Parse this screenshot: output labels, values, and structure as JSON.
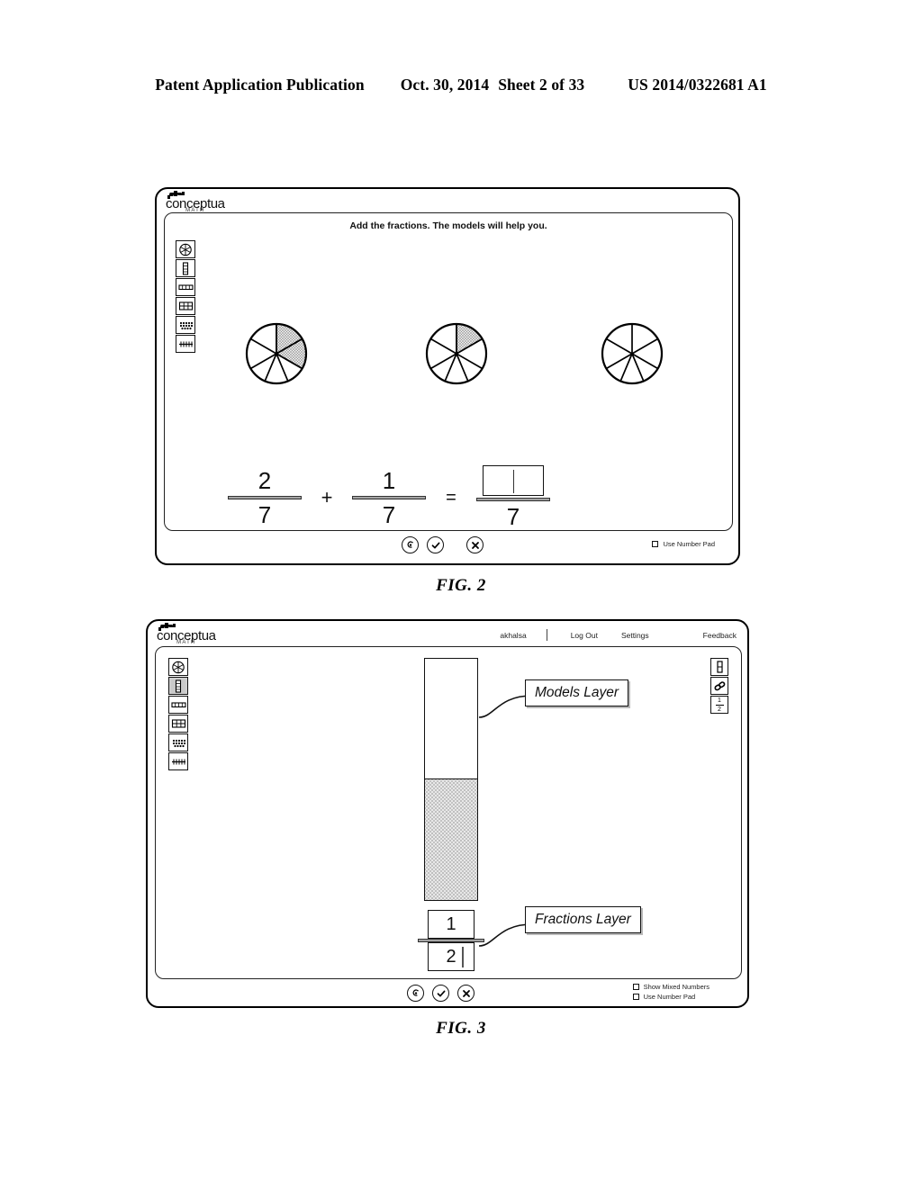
{
  "patent_header": {
    "publication": "Patent Application Publication",
    "date": "Oct. 30, 2014",
    "sheet": "Sheet 2 of 33",
    "number": "US 2014/0322681 A1"
  },
  "figures": [
    {
      "caption": "FIG. 2",
      "logo": {
        "word": "conceptua",
        "sub": "MATH"
      },
      "prompt": "Add the fractions. The models will help you.",
      "palette": [
        {
          "name": "circle-model-tool",
          "label": "Circle Model",
          "selected": false
        },
        {
          "name": "vertical-bar-model-tool",
          "label": "Vertical Bar Model",
          "selected": false
        },
        {
          "name": "horizontal-bar-model-tool",
          "label": "Horizontal Bar Model",
          "selected": false
        },
        {
          "name": "grid-model-tool",
          "label": "Grid Model",
          "selected": false
        },
        {
          "name": "set-model-tool",
          "label": "Set Model",
          "selected": false
        },
        {
          "name": "number-line-model-tool",
          "label": "Number Line Model",
          "selected": false
        }
      ],
      "models": [
        {
          "name": "circle-model-addend-1",
          "slices": 7,
          "shaded": 2
        },
        {
          "name": "circle-model-addend-2",
          "slices": 7,
          "shaded": 1
        },
        {
          "name": "circle-model-answer",
          "slices": 7,
          "shaded": 0
        }
      ],
      "equation": {
        "addend_1": {
          "numerator": "2",
          "denominator": "7"
        },
        "operator": "+",
        "addend_2": {
          "numerator": "1",
          "denominator": "7"
        },
        "equals": "=",
        "answer": {
          "numerator": "",
          "denominator": "7"
        }
      },
      "buttons": [
        {
          "name": "hint-button",
          "label": "Hint"
        },
        {
          "name": "check-answer-button",
          "label": "Check"
        },
        {
          "name": "close-button",
          "label": "Close"
        }
      ],
      "checkboxes": [
        {
          "name": "use-number-pad-checkbox",
          "label": "Use Number Pad",
          "checked": false
        }
      ]
    },
    {
      "caption": "FIG. 3",
      "logo": {
        "word": "conceptua",
        "sub": "MATH"
      },
      "nav": [
        {
          "name": "username",
          "label": "akhalsa"
        },
        {
          "name": "log-out-link",
          "label": "Log Out"
        },
        {
          "name": "settings-link",
          "label": "Settings"
        },
        {
          "name": "feedback-link",
          "label": "Feedback"
        }
      ],
      "palette": [
        {
          "name": "circle-model-tool",
          "label": "Circle Model",
          "selected": false
        },
        {
          "name": "vertical-bar-model-tool",
          "label": "Vertical Bar Model",
          "selected": true
        },
        {
          "name": "horizontal-bar-model-tool",
          "label": "Horizontal Bar Model",
          "selected": false
        },
        {
          "name": "grid-model-tool",
          "label": "Grid Model",
          "selected": false
        },
        {
          "name": "set-model-tool",
          "label": "Set Model",
          "selected": false
        },
        {
          "name": "number-line-model-tool",
          "label": "Number Line Model",
          "selected": false
        }
      ],
      "right_panel": [
        {
          "name": "bar-model-tool",
          "label": "Bar Model"
        },
        {
          "name": "link-tool",
          "label": "Link"
        },
        {
          "name": "fraction-tool",
          "numerator": "1",
          "denominator": "2"
        }
      ],
      "bar_model": {
        "name": "vertical-bar-model",
        "fraction": "1/2",
        "fill_ratio": 0.5
      },
      "callouts": [
        {
          "name": "models-layer-callout",
          "label": "Models Layer"
        },
        {
          "name": "fractions-layer-callout",
          "label": "Fractions Layer"
        }
      ],
      "fraction_input": {
        "numerator": "1",
        "denominator": "2"
      },
      "buttons": [
        {
          "name": "hint-button",
          "label": "Hint"
        },
        {
          "name": "check-answer-button",
          "label": "Check"
        },
        {
          "name": "close-button",
          "label": "Close"
        }
      ],
      "checkboxes": [
        {
          "name": "show-mixed-numbers-checkbox",
          "label": "Show Mixed Numbers",
          "checked": false
        },
        {
          "name": "use-number-pad-checkbox",
          "label": "Use Number Pad",
          "checked": false
        }
      ]
    }
  ]
}
